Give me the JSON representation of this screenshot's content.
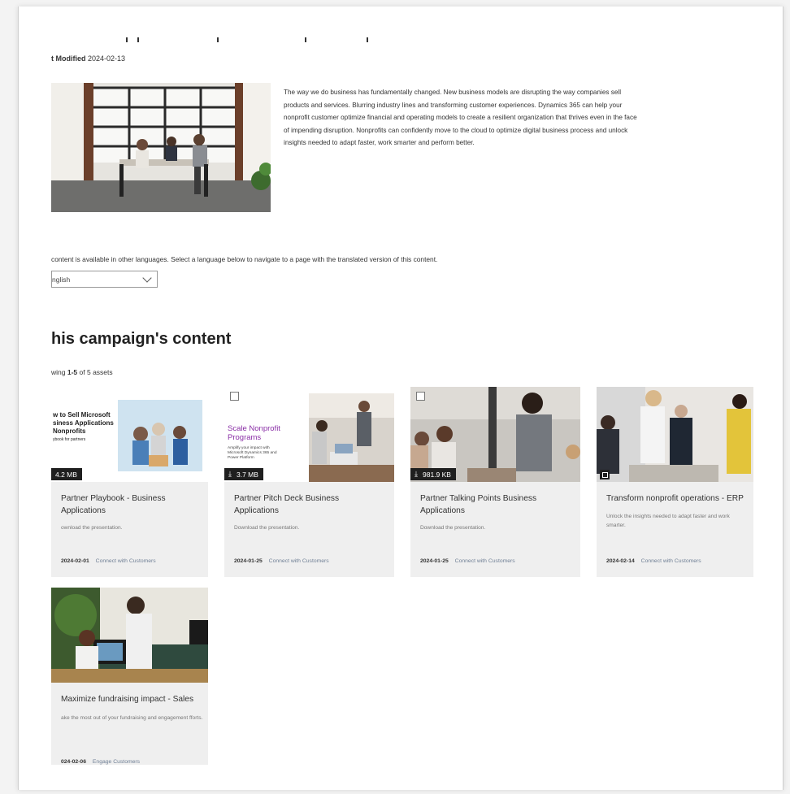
{
  "page": {
    "modified_label": "t Modified",
    "modified_date": "2024-02-13"
  },
  "intro_text": "The way we do business has fundamentally changed. New business models are disrupting the way companies sell products and services. Blurring industry lines and transforming customer experiences. Dynamics 365 can help your nonprofit customer optimize financial and operating models to create a resilient organization that thrives even in the face of impending disruption. Nonprofits can confidently move to the cloud to optimize digital business process and unlock insights needed to adapt faster, work smarter and perform better.",
  "language": {
    "note": "content is available in other languages. Select a language below to navigate to a page with the translated version of this content.",
    "selected": "nglish"
  },
  "section": {
    "title": "his campaign's content",
    "showing_prefix": "wing",
    "showing_range": "1-5",
    "showing_suffix": "of 5 assets"
  },
  "cards": [
    {
      "title": "Partner Playbook - Business Applications",
      "desc": "ownload the presentation.",
      "date": "2024-02-01",
      "tag": "Connect with Customers",
      "size": "4.2 MB",
      "thumb_text": [
        "w to Sell Microsoft",
        "siness Applications",
        "Nonprofits",
        "ybook for partners"
      ]
    },
    {
      "title": "Partner Pitch Deck Business Applications",
      "desc": "Download the presentation.",
      "date": "2024-01-25",
      "tag": "Connect with Customers",
      "size": "3.7 MB",
      "thumb_text": [
        "Scale Nonprofit",
        "Programs",
        "Amplify your impact with",
        "Microsoft Dynamics 365 and",
        "Power Platform"
      ]
    },
    {
      "title": "Partner Talking Points Business Applications",
      "desc": "Download the presentation.",
      "date": "2024-01-25",
      "tag": "Connect with Customers",
      "size": "981.9 KB"
    },
    {
      "title": "Transform nonprofit operations - ERP",
      "desc": "Unlock the insights needed to adapt faster and work smarter.",
      "date": "2024-02-14",
      "tag": "Connect with Customers"
    },
    {
      "title": "Maximize fundraising impact - Sales",
      "desc": "ake the most out of your fundraising and engagement fforts.",
      "date": "024-02-06",
      "tag": "Engage Customers"
    }
  ],
  "colors": {
    "accent_purple": "#8a2fa6",
    "card_bg": "#efefef",
    "badge_bg": "#1f1f1f"
  }
}
